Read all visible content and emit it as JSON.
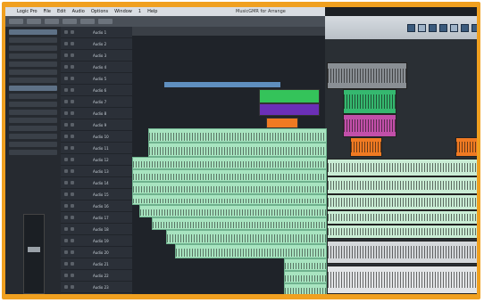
{
  "menubar": {
    "app_name": "Logic Pro",
    "items": [
      "File",
      "Edit",
      "Audio",
      "Options",
      "Window",
      "1",
      "Help"
    ],
    "window_title": "MusicGMR for Arrange"
  },
  "colors": {
    "frame": "#f0a020",
    "audio_region": "#a8e4c0",
    "midi_green": "#34c35a",
    "midi_purple": "#6b2fb7",
    "midi_orange": "#f07a22",
    "right_pink": "#c24fa9",
    "right_green": "#35b86f"
  },
  "tracks": [
    {
      "name": "Audio 1"
    },
    {
      "name": "Audio 2"
    },
    {
      "name": "Audio 3"
    },
    {
      "name": "Audio 4"
    },
    {
      "name": "Audio 5"
    },
    {
      "name": "Audio 6"
    },
    {
      "name": "Audio 7"
    },
    {
      "name": "Audio 8"
    },
    {
      "name": "Audio 9"
    },
    {
      "name": "Audio 10"
    },
    {
      "name": "Audio 11"
    },
    {
      "name": "Audio 12"
    },
    {
      "name": "Audio 13"
    },
    {
      "name": "Audio 14"
    },
    {
      "name": "Audio 15"
    },
    {
      "name": "Audio 16"
    },
    {
      "name": "Audio 17"
    },
    {
      "name": "Audio 18"
    },
    {
      "name": "Audio 19"
    },
    {
      "name": "Audio 20"
    },
    {
      "name": "Audio 21"
    },
    {
      "name": "Audio 22"
    },
    {
      "name": "Audio 23"
    }
  ]
}
